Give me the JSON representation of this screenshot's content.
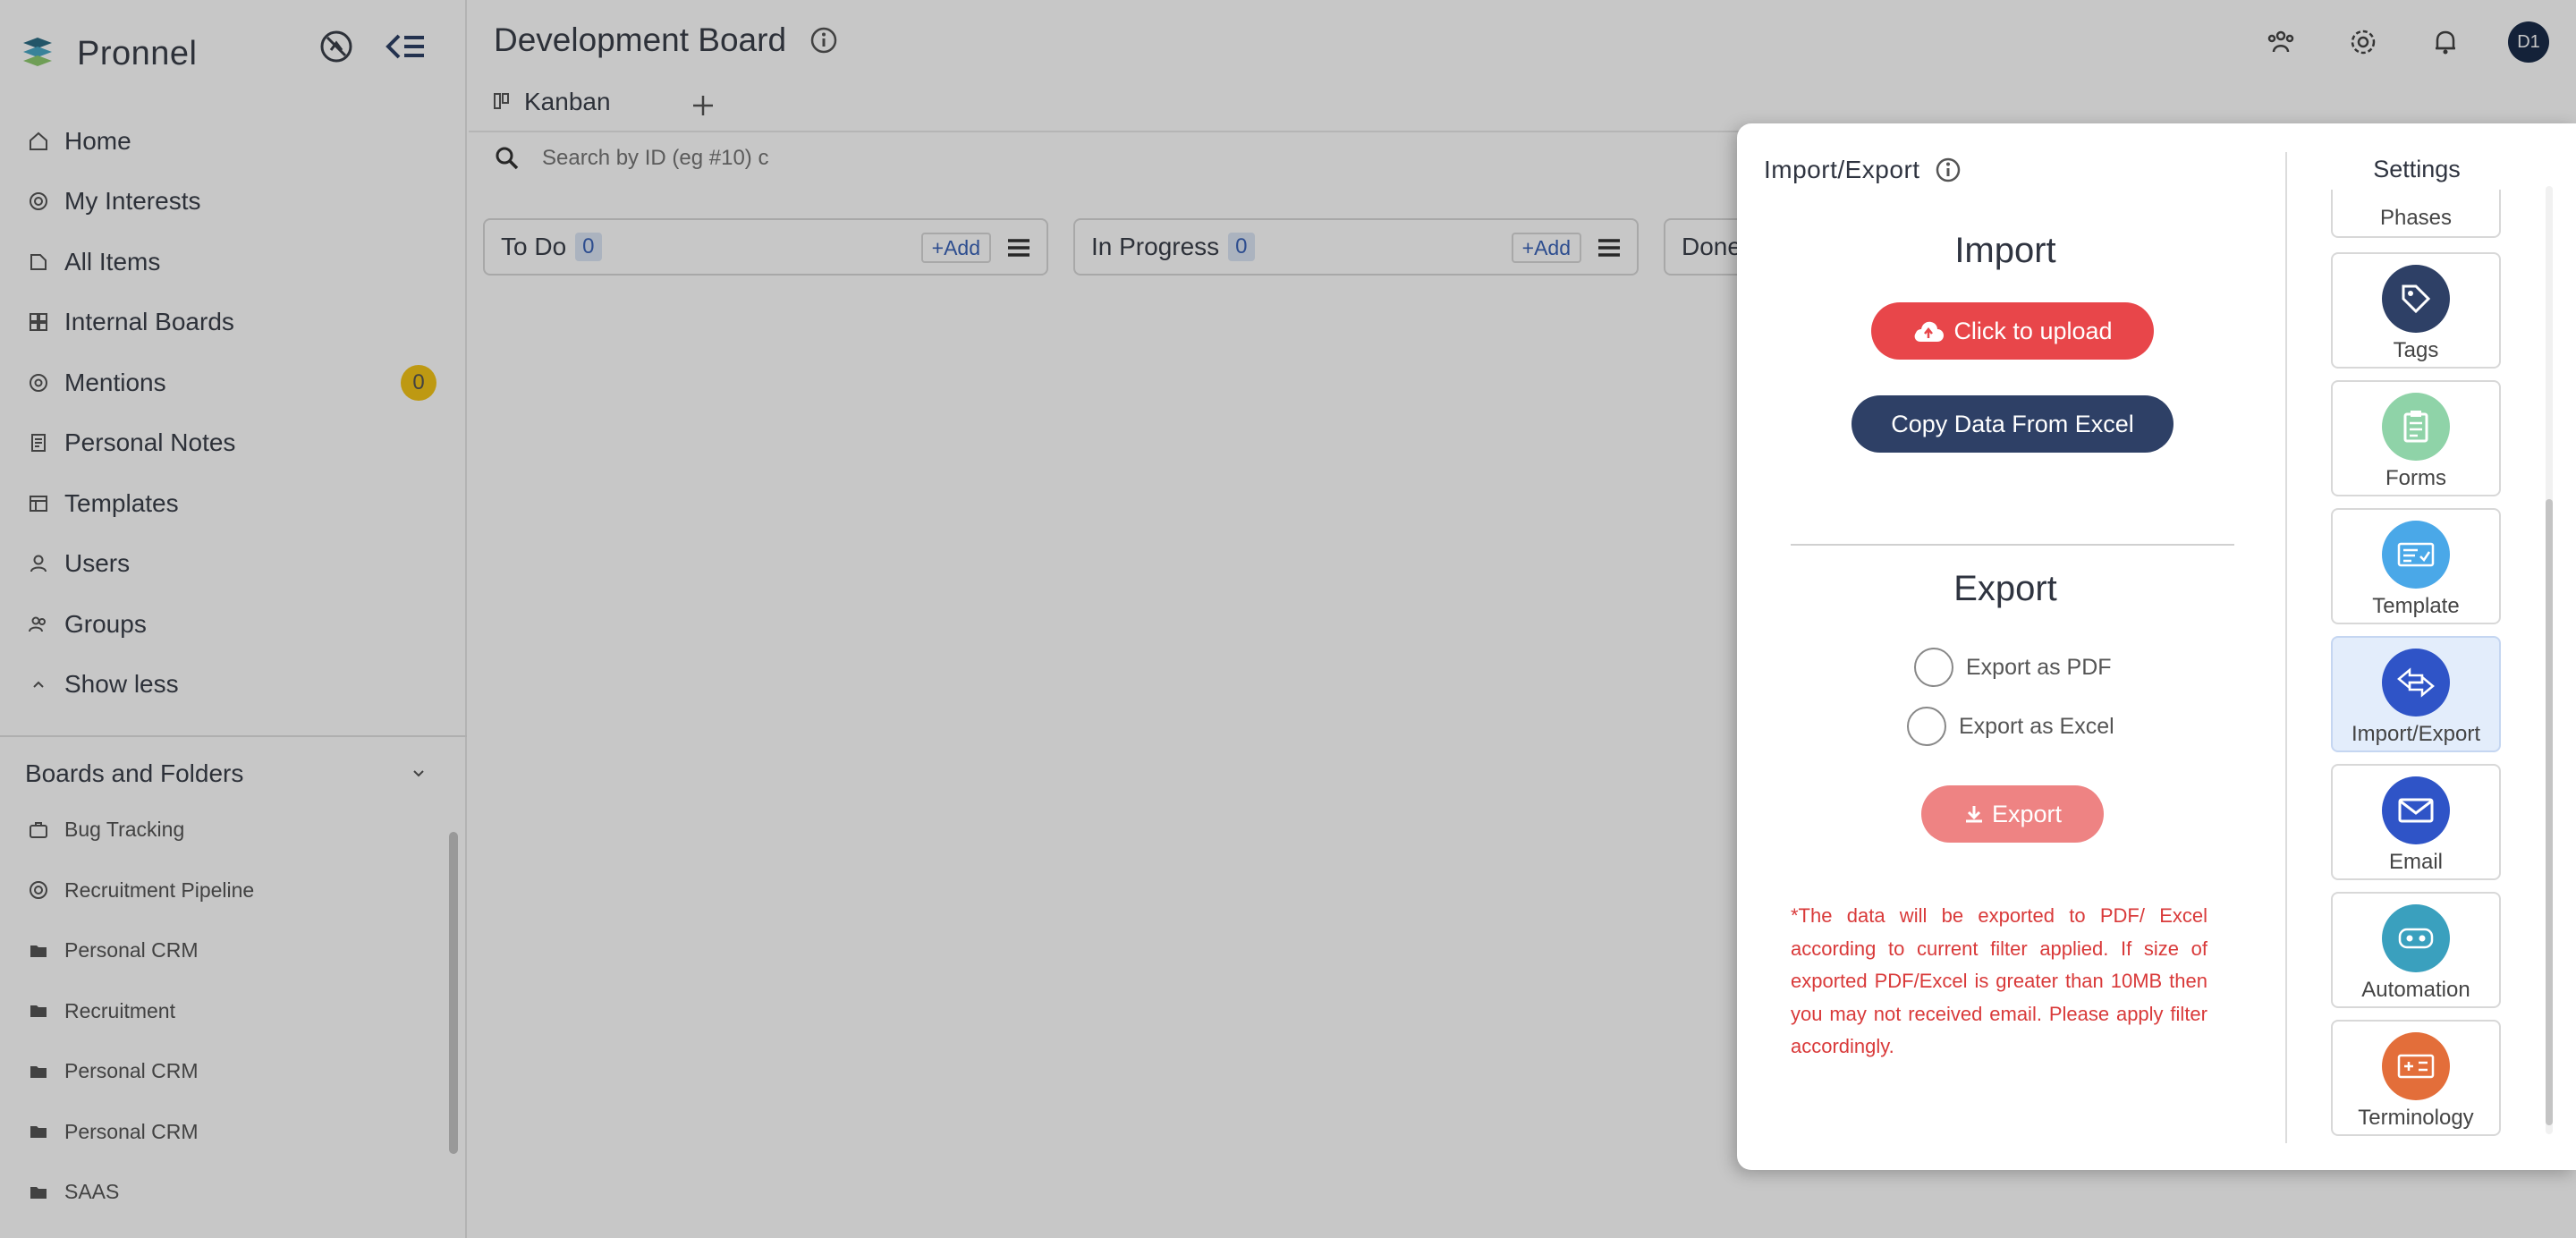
{
  "brand": {
    "name": "Pronnel"
  },
  "sidebar": {
    "items": [
      {
        "label": "Home",
        "icon": "home-icon"
      },
      {
        "label": "My Interests",
        "icon": "interests-icon"
      },
      {
        "label": "All Items",
        "icon": "all-items-icon"
      },
      {
        "label": "Internal Boards",
        "icon": "boards-icon"
      },
      {
        "label": "Mentions",
        "icon": "at-icon",
        "badge": "0"
      },
      {
        "label": "Personal Notes",
        "icon": "notes-icon"
      },
      {
        "label": "Templates",
        "icon": "templates-icon"
      },
      {
        "label": "Users",
        "icon": "user-icon"
      },
      {
        "label": "Groups",
        "icon": "groups-icon"
      },
      {
        "label": "Show less",
        "icon": "chevron-up-icon"
      }
    ],
    "folders_header": "Boards and Folders",
    "folders": [
      {
        "label": "Bug Tracking",
        "icon": "briefcase-icon"
      },
      {
        "label": "Recruitment Pipeline",
        "icon": "target-icon"
      },
      {
        "label": "Personal CRM",
        "icon": "folder-icon"
      },
      {
        "label": "Recruitment",
        "icon": "folder-icon"
      },
      {
        "label": "Personal CRM",
        "icon": "folder-icon"
      },
      {
        "label": "Personal CRM",
        "icon": "folder-icon"
      },
      {
        "label": "SAAS",
        "icon": "folder-icon"
      }
    ]
  },
  "header": {
    "title": "Development Board",
    "avatar": "D1"
  },
  "tabs": [
    {
      "label": "Kanban"
    }
  ],
  "search": {
    "placeholder": "Search by ID (eg #10) c"
  },
  "columns": [
    {
      "title": "To Do",
      "count": "0",
      "add": "+Add"
    },
    {
      "title": "In Progress",
      "count": "0",
      "add": "+Add"
    },
    {
      "title": "Done"
    }
  ],
  "panel": {
    "title": "Import/Export",
    "import_title": "Import",
    "upload_label": "Click to upload",
    "copy_excel_label": "Copy Data From Excel",
    "export_title": "Export",
    "export_pdf": "Export as PDF",
    "export_excel": "Export as Excel",
    "export_button": "Export",
    "note": "*The data will be exported to PDF/ Excel according to current filter applied. If size of exported PDF/Excel is greater than 10MB then you may not received email. Please apply filter accordingly."
  },
  "settings": {
    "title": "Settings",
    "partial": "Phases",
    "cards": [
      {
        "label": "Tags",
        "color": "#2e4066",
        "icon": "tag-icon"
      },
      {
        "label": "Forms",
        "color": "#8fd3a8",
        "icon": "clipboard-icon"
      },
      {
        "label": "Template",
        "color": "#4aa8e8",
        "icon": "template-icon"
      },
      {
        "label": "Import/Export",
        "color": "#2f54c7",
        "icon": "import-export-icon",
        "active": true
      },
      {
        "label": "Email",
        "color": "#2f54c7",
        "icon": "envelope-icon"
      },
      {
        "label": "Automation",
        "color": "#3aa0be",
        "icon": "automation-icon"
      },
      {
        "label": "Terminology",
        "color": "#e36e3a",
        "icon": "terminology-icon"
      }
    ]
  },
  "colors": {
    "upload": "#e8464a",
    "excel": "#2e4066",
    "export": "#ee8383",
    "note": "#d93a3a"
  }
}
